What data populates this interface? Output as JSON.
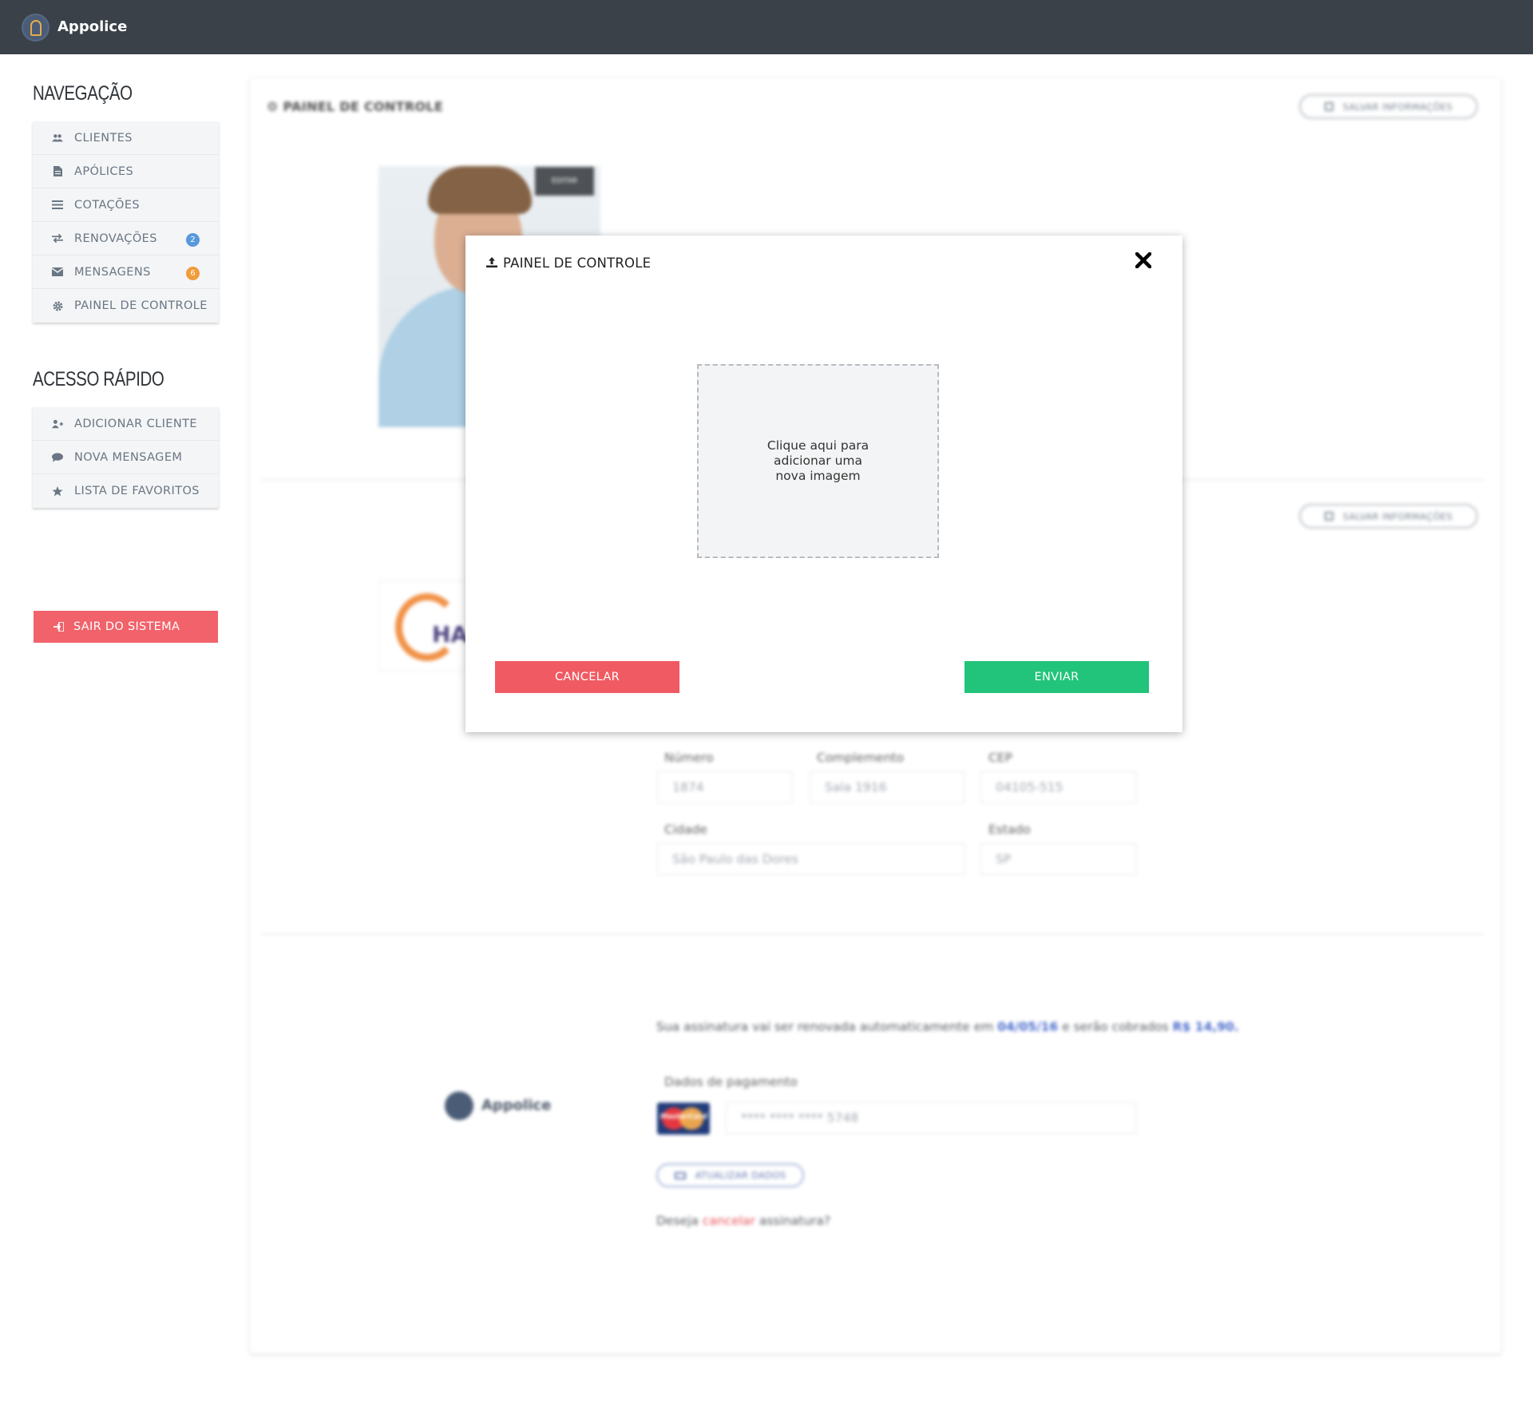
{
  "app": {
    "name": "Appolice"
  },
  "sidebar": {
    "nav_title": "NAVEGAÇÃO",
    "nav_items": [
      {
        "label": "CLIENTES",
        "icon": "users-icon"
      },
      {
        "label": "APÓLICES",
        "icon": "document-icon"
      },
      {
        "label": "COTAÇÕES",
        "icon": "list-icon"
      },
      {
        "label": "RENOVAÇÕES",
        "icon": "exchange-icon",
        "badge": "2",
        "badge_color": "#4a90d9"
      },
      {
        "label": "MENSAGENS",
        "icon": "envelope-icon",
        "badge": "6",
        "badge_color": "#f0932b"
      },
      {
        "label": "PAINEL DE CONTROLE",
        "icon": "gear-icon"
      }
    ],
    "quick_title": "ACESSO RÁPIDO",
    "quick_items": [
      {
        "label": "ADICIONAR CLIENTE",
        "icon": "add-user-icon"
      },
      {
        "label": "NOVA MENSAGEM",
        "icon": "chat-icon"
      },
      {
        "label": "LISTA DE FAVORITOS",
        "icon": "star-icon"
      }
    ],
    "exit_label": "SAIR DO SISTEMA"
  },
  "main": {
    "panel_title": "PAINEL DE CONTROLE",
    "save_label": "SALVAR INFORMAÇÕES",
    "edit_label": "EDITAR",
    "company_logo_text": "HA",
    "address": {
      "numero_label": "Número",
      "numero_value": "1874",
      "complemento_label": "Complemento",
      "complemento_value": "Sala 1916",
      "cep_label": "CEP",
      "cep_value": "04105-515",
      "cidade_label": "Cidade",
      "cidade_value": "São Paulo das Dores",
      "estado_label": "Estado",
      "estado_value": "SP"
    },
    "subscription": {
      "renew_prefix": "Sua assinatura vai ser renovada automaticamente em",
      "renew_date": "04/05/16",
      "renew_middle": "e serão cobrados",
      "renew_price": "R$ 14,90",
      "renew_suffix": ".",
      "payment_label": "Dados de pagamento",
      "card_brand": "MasterCard",
      "card_number": "**** **** **** 5748",
      "update_label": "ATUALIZAR DADOS",
      "cancel_prefix": "Deseja",
      "cancel_link": "cancelar",
      "cancel_suffix": "assinatura?",
      "brand_name": "Appolice"
    }
  },
  "modal": {
    "title": "PAINEL DE CONTROLE",
    "dropzone_text": "Clique aqui para adicionar uma nova imagem",
    "cancel_label": "CANCELAR",
    "send_label": "ENVIAR"
  },
  "colors": {
    "topbar": "#2a3139",
    "danger": "#f0555e",
    "success": "#21c47a",
    "link": "#3a5ec8"
  }
}
